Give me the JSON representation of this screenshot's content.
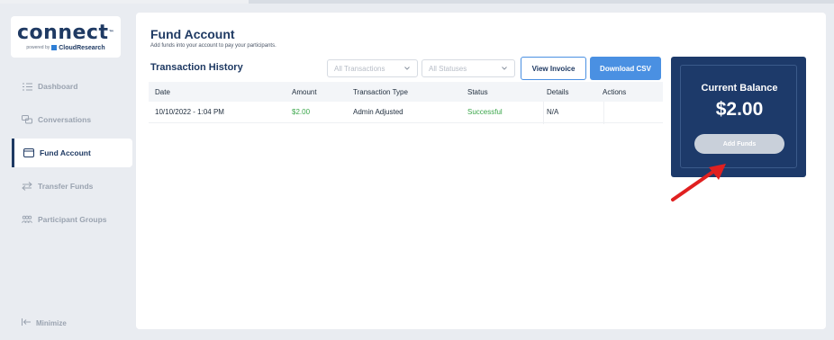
{
  "brand": {
    "logo_word": "connect",
    "logo_tm": "™",
    "powered_by": "powered by",
    "company": "CloudResearch"
  },
  "sidebar": {
    "items": [
      {
        "label": "Dashboard",
        "icon": "list-icon",
        "active": false
      },
      {
        "label": "Conversations",
        "icon": "chat-icon",
        "active": false
      },
      {
        "label": "Fund Account",
        "icon": "wallet-icon",
        "active": true
      },
      {
        "label": "Transfer Funds",
        "icon": "transfer-icon",
        "active": false
      },
      {
        "label": "Participant Groups",
        "icon": "group-icon",
        "active": false
      }
    ],
    "minimize_label": "Minimize"
  },
  "page": {
    "title": "Fund Account",
    "subtitle": "Add funds into your account to pay your participants."
  },
  "transactions": {
    "title": "Transaction History",
    "filter_type_placeholder": "All Transactions",
    "filter_status_placeholder": "All Statuses",
    "view_invoice_label": "View Invoice",
    "download_csv_label": "Download CSV",
    "columns": [
      "Date",
      "Amount",
      "Transaction Type",
      "Status",
      "Details",
      "Actions"
    ],
    "rows": [
      {
        "date": "10/10/2022 - 1:04 PM",
        "amount": "$2.00",
        "type": "Admin Adjusted",
        "status": "Successful",
        "details": "N/A",
        "actions": ""
      }
    ]
  },
  "balance": {
    "label": "Current Balance",
    "value": "$2.00",
    "add_funds_label": "Add Funds"
  },
  "colors": {
    "navy": "#1d3a6a",
    "accent_blue": "#4a90e2",
    "success_green": "#3aa64a",
    "annotation_red": "#e02020"
  }
}
